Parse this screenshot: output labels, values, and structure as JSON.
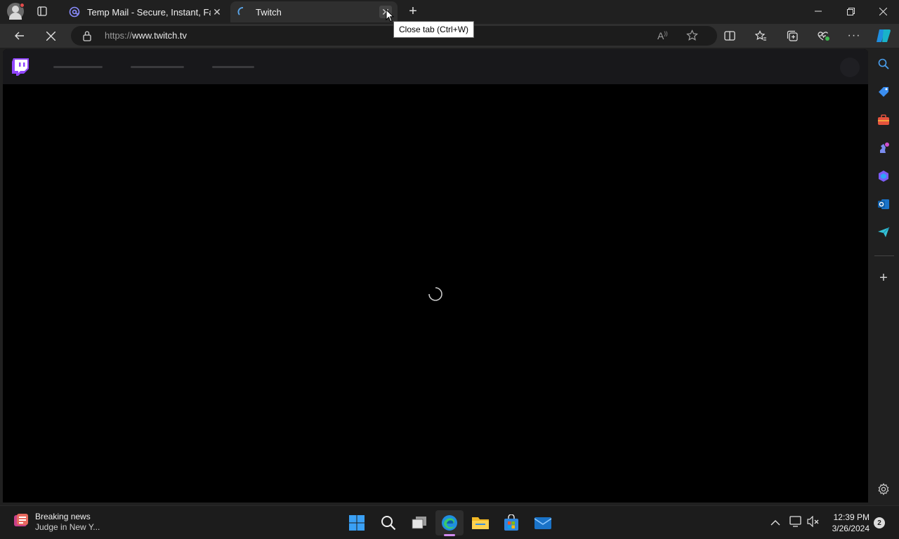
{
  "browser": {
    "tabs": [
      {
        "title": "Temp Mail - Secure, Instant, Fast",
        "favicon": "at-sign-icon",
        "active": false
      },
      {
        "title": "Twitch",
        "favicon": "loading-icon",
        "active": true
      }
    ],
    "address": {
      "scheme": "https://",
      "host": "www.twitch.tv"
    },
    "tooltip": "Close tab (Ctrl+W)"
  },
  "taskbar": {
    "news_title": "Breaking news",
    "news_subtitle": "Judge in New Y...",
    "time": "12:39 PM",
    "date": "3/26/2024",
    "notification_count": "2"
  },
  "colors": {
    "twitch_purple": "#9146ff",
    "edge_accent": "#1f8ee0",
    "windows_blue": "#0a84ff"
  }
}
